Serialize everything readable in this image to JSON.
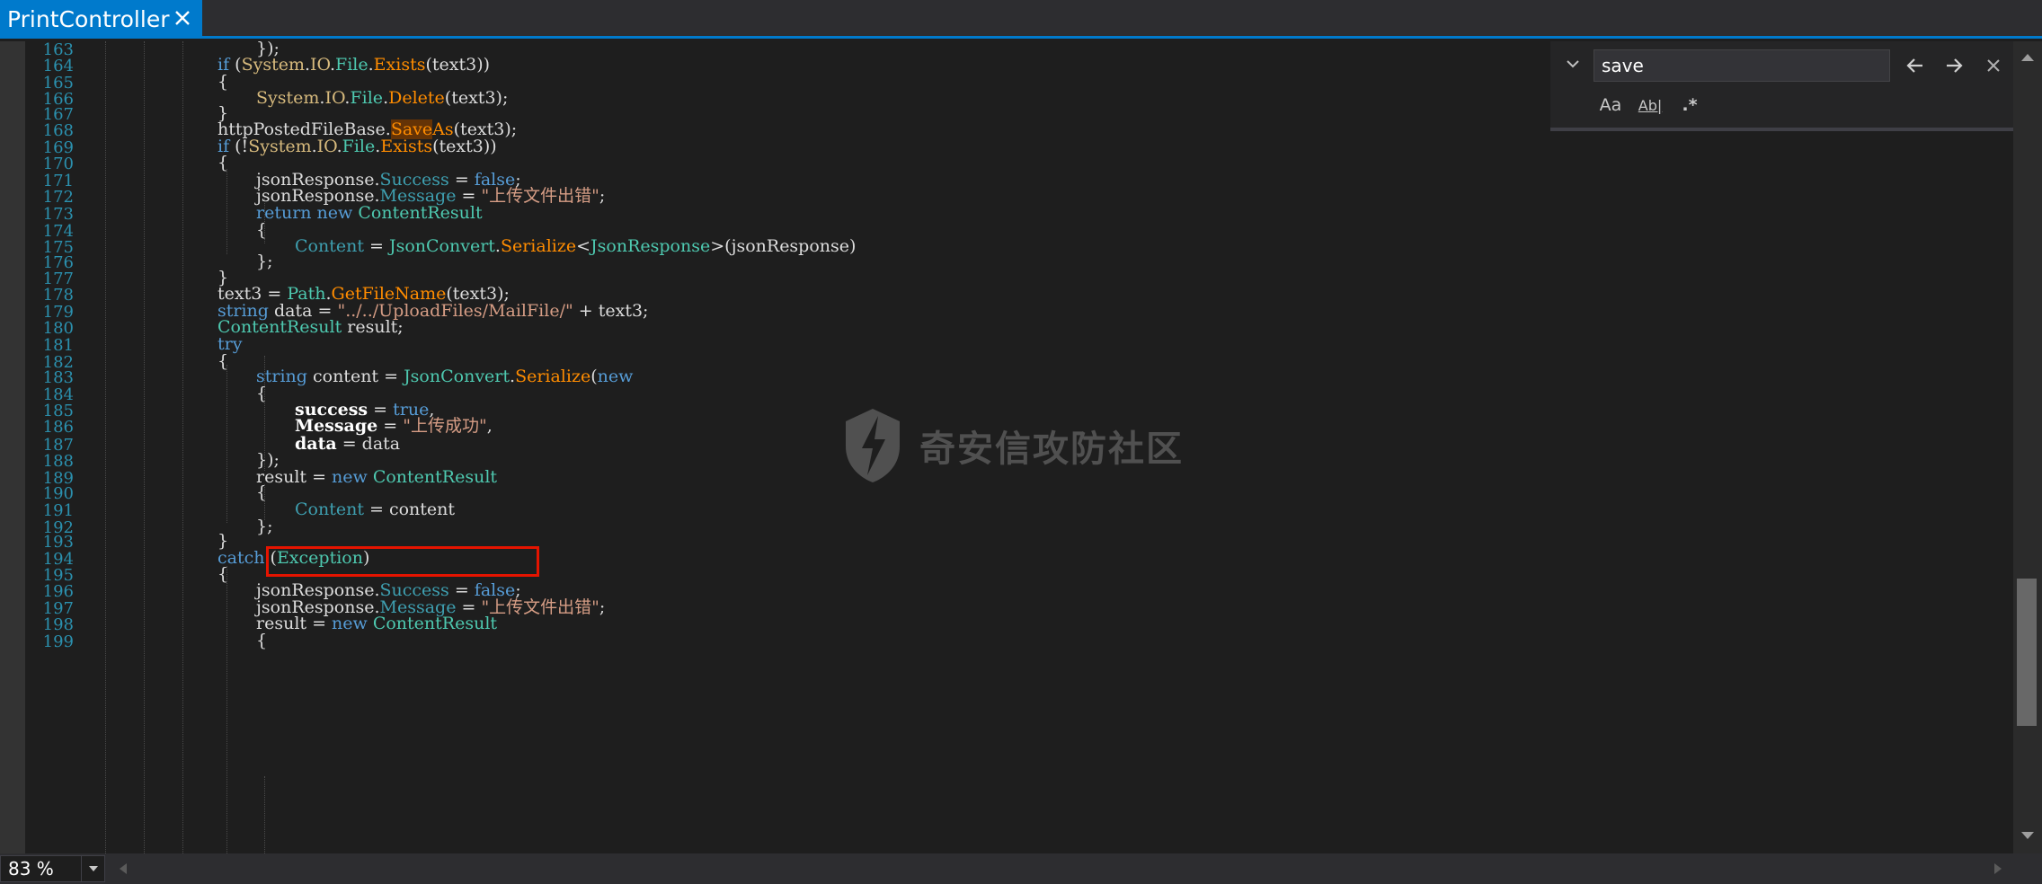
{
  "tab": {
    "title": "PrintController"
  },
  "find": {
    "query": "save",
    "match_case_label": "Aa",
    "whole_word_label": "Ab|",
    "regex_label": ".*"
  },
  "status": {
    "zoom": "83 %"
  },
  "watermark": "奇安信攻防社区",
  "code": {
    "lines": [
      {
        "n": "163",
        "indent": 1,
        "html": "});"
      },
      {
        "n": "164",
        "indent": 0,
        "html": "<span class=\"kw\">if</span> (<span class=\"ns\">System</span>.<span class=\"ns\">IO</span>.<span class=\"ty\">File</span>.<span class=\"me\">Exists</span>(text3))"
      },
      {
        "n": "165",
        "indent": 0,
        "html": "{"
      },
      {
        "n": "166",
        "indent": 1,
        "html": "<span class=\"ns\">System</span>.<span class=\"ns\">IO</span>.<span class=\"ty\">File</span>.<span class=\"me\">Delete</span>(text3);"
      },
      {
        "n": "167",
        "indent": 0,
        "html": "}"
      },
      {
        "n": "168",
        "indent": 0,
        "html": "httpPostedFileBase.<span class=\"me\"><span class=\"hl\">Save</span>As</span>(text3);"
      },
      {
        "n": "169",
        "indent": 0,
        "html": "<span class=\"kw\">if</span> (!<span class=\"ns\">System</span>.<span class=\"ns\">IO</span>.<span class=\"ty\">File</span>.<span class=\"me\">Exists</span>(text3))"
      },
      {
        "n": "170",
        "indent": 0,
        "html": "{"
      },
      {
        "n": "171",
        "indent": 1,
        "html": "jsonResponse.<span class=\"pr\">Success</span> = <span class=\"kw\">false</span>;"
      },
      {
        "n": "172",
        "indent": 1,
        "html": "jsonResponse.<span class=\"pr\">Message</span> = <span class=\"st\">\"上传文件出错\"</span>;"
      },
      {
        "n": "173",
        "indent": 1,
        "html": "<span class=\"kw\">return new</span> <span class=\"ty\">ContentResult</span>"
      },
      {
        "n": "174",
        "indent": 1,
        "html": "{"
      },
      {
        "n": "175",
        "indent": 2,
        "html": "<span class=\"pr\">Content</span> = <span class=\"ty\">JsonConvert</span>.<span class=\"me\">Serialize</span>&lt;<span class=\"ty\">JsonResponse</span>&gt;(jsonResponse)"
      },
      {
        "n": "176",
        "indent": 1,
        "html": "};"
      },
      {
        "n": "177",
        "indent": 0,
        "html": "}"
      },
      {
        "n": "178",
        "indent": 0,
        "html": "text3 = <span class=\"ty\">Path</span>.<span class=\"me\">GetFileName</span>(text3);"
      },
      {
        "n": "179",
        "indent": 0,
        "html": "<span class=\"kw\">string</span> data = <span class=\"st\">\"../../UploadFiles/MailFile/\"</span> + text3;"
      },
      {
        "n": "180",
        "indent": 0,
        "html": "<span class=\"ty\">ContentResult</span> result;"
      },
      {
        "n": "181",
        "indent": 0,
        "html": "<span class=\"kw\">try</span>"
      },
      {
        "n": "182",
        "indent": 0,
        "html": "{"
      },
      {
        "n": "183",
        "indent": 1,
        "html": "<span class=\"kw\">string</span> content = <span class=\"ty\">JsonConvert</span>.<span class=\"me\">Serialize</span>(<span class=\"kw\">new</span>"
      },
      {
        "n": "184",
        "indent": 1,
        "html": "{"
      },
      {
        "n": "185",
        "indent": 2,
        "html": "<span class=\"bo\">success</span> = <span class=\"kw\">true</span>,"
      },
      {
        "n": "186",
        "indent": 2,
        "html": "<span class=\"bo\">Message</span> = <span class=\"st\">\"上传成功\"</span>,"
      },
      {
        "n": "187",
        "indent": 2,
        "html": "<span class=\"bo\">data</span> = data"
      },
      {
        "n": "188",
        "indent": 1,
        "html": "});"
      },
      {
        "n": "189",
        "indent": 1,
        "html": "result = <span class=\"kw\">new</span> <span class=\"ty\">ContentResult</span>"
      },
      {
        "n": "190",
        "indent": 1,
        "html": "{"
      },
      {
        "n": "191",
        "indent": 2,
        "html": "<span class=\"pr\">Content</span> = content"
      },
      {
        "n": "192",
        "indent": 1,
        "html": "};"
      },
      {
        "n": "193",
        "indent": 0,
        "html": "}"
      },
      {
        "n": "194",
        "indent": 0,
        "html": "<span class=\"kw\">catch</span> (<span class=\"ty\">Exception</span>)"
      },
      {
        "n": "195",
        "indent": 0,
        "html": "{"
      },
      {
        "n": "196",
        "indent": 1,
        "html": "jsonResponse.<span class=\"pr\">Success</span> = <span class=\"kw\">false</span>;"
      },
      {
        "n": "197",
        "indent": 1,
        "html": "jsonResponse.<span class=\"pr\">Message</span> = <span class=\"st\">\"上传文件出错\"</span>;"
      },
      {
        "n": "198",
        "indent": 1,
        "html": "result = <span class=\"kw\">new</span> <span class=\"ty\">ContentResult</span>"
      },
      {
        "n": "199",
        "indent": 1,
        "html": "{"
      }
    ]
  },
  "colors": {
    "accent": "#007acc",
    "editor_bg": "#1e1e1e",
    "line_number": "#2b91af",
    "keyword": "#569cd6",
    "type": "#4ec9b0",
    "method": "#ff8c00",
    "string": "#d69d85",
    "annotation_box": "#e51400"
  },
  "icons": [
    "close-icon",
    "chevron-down-icon",
    "arrow-left-icon",
    "arrow-right-icon",
    "close-icon",
    "chevron-down-icon"
  ]
}
